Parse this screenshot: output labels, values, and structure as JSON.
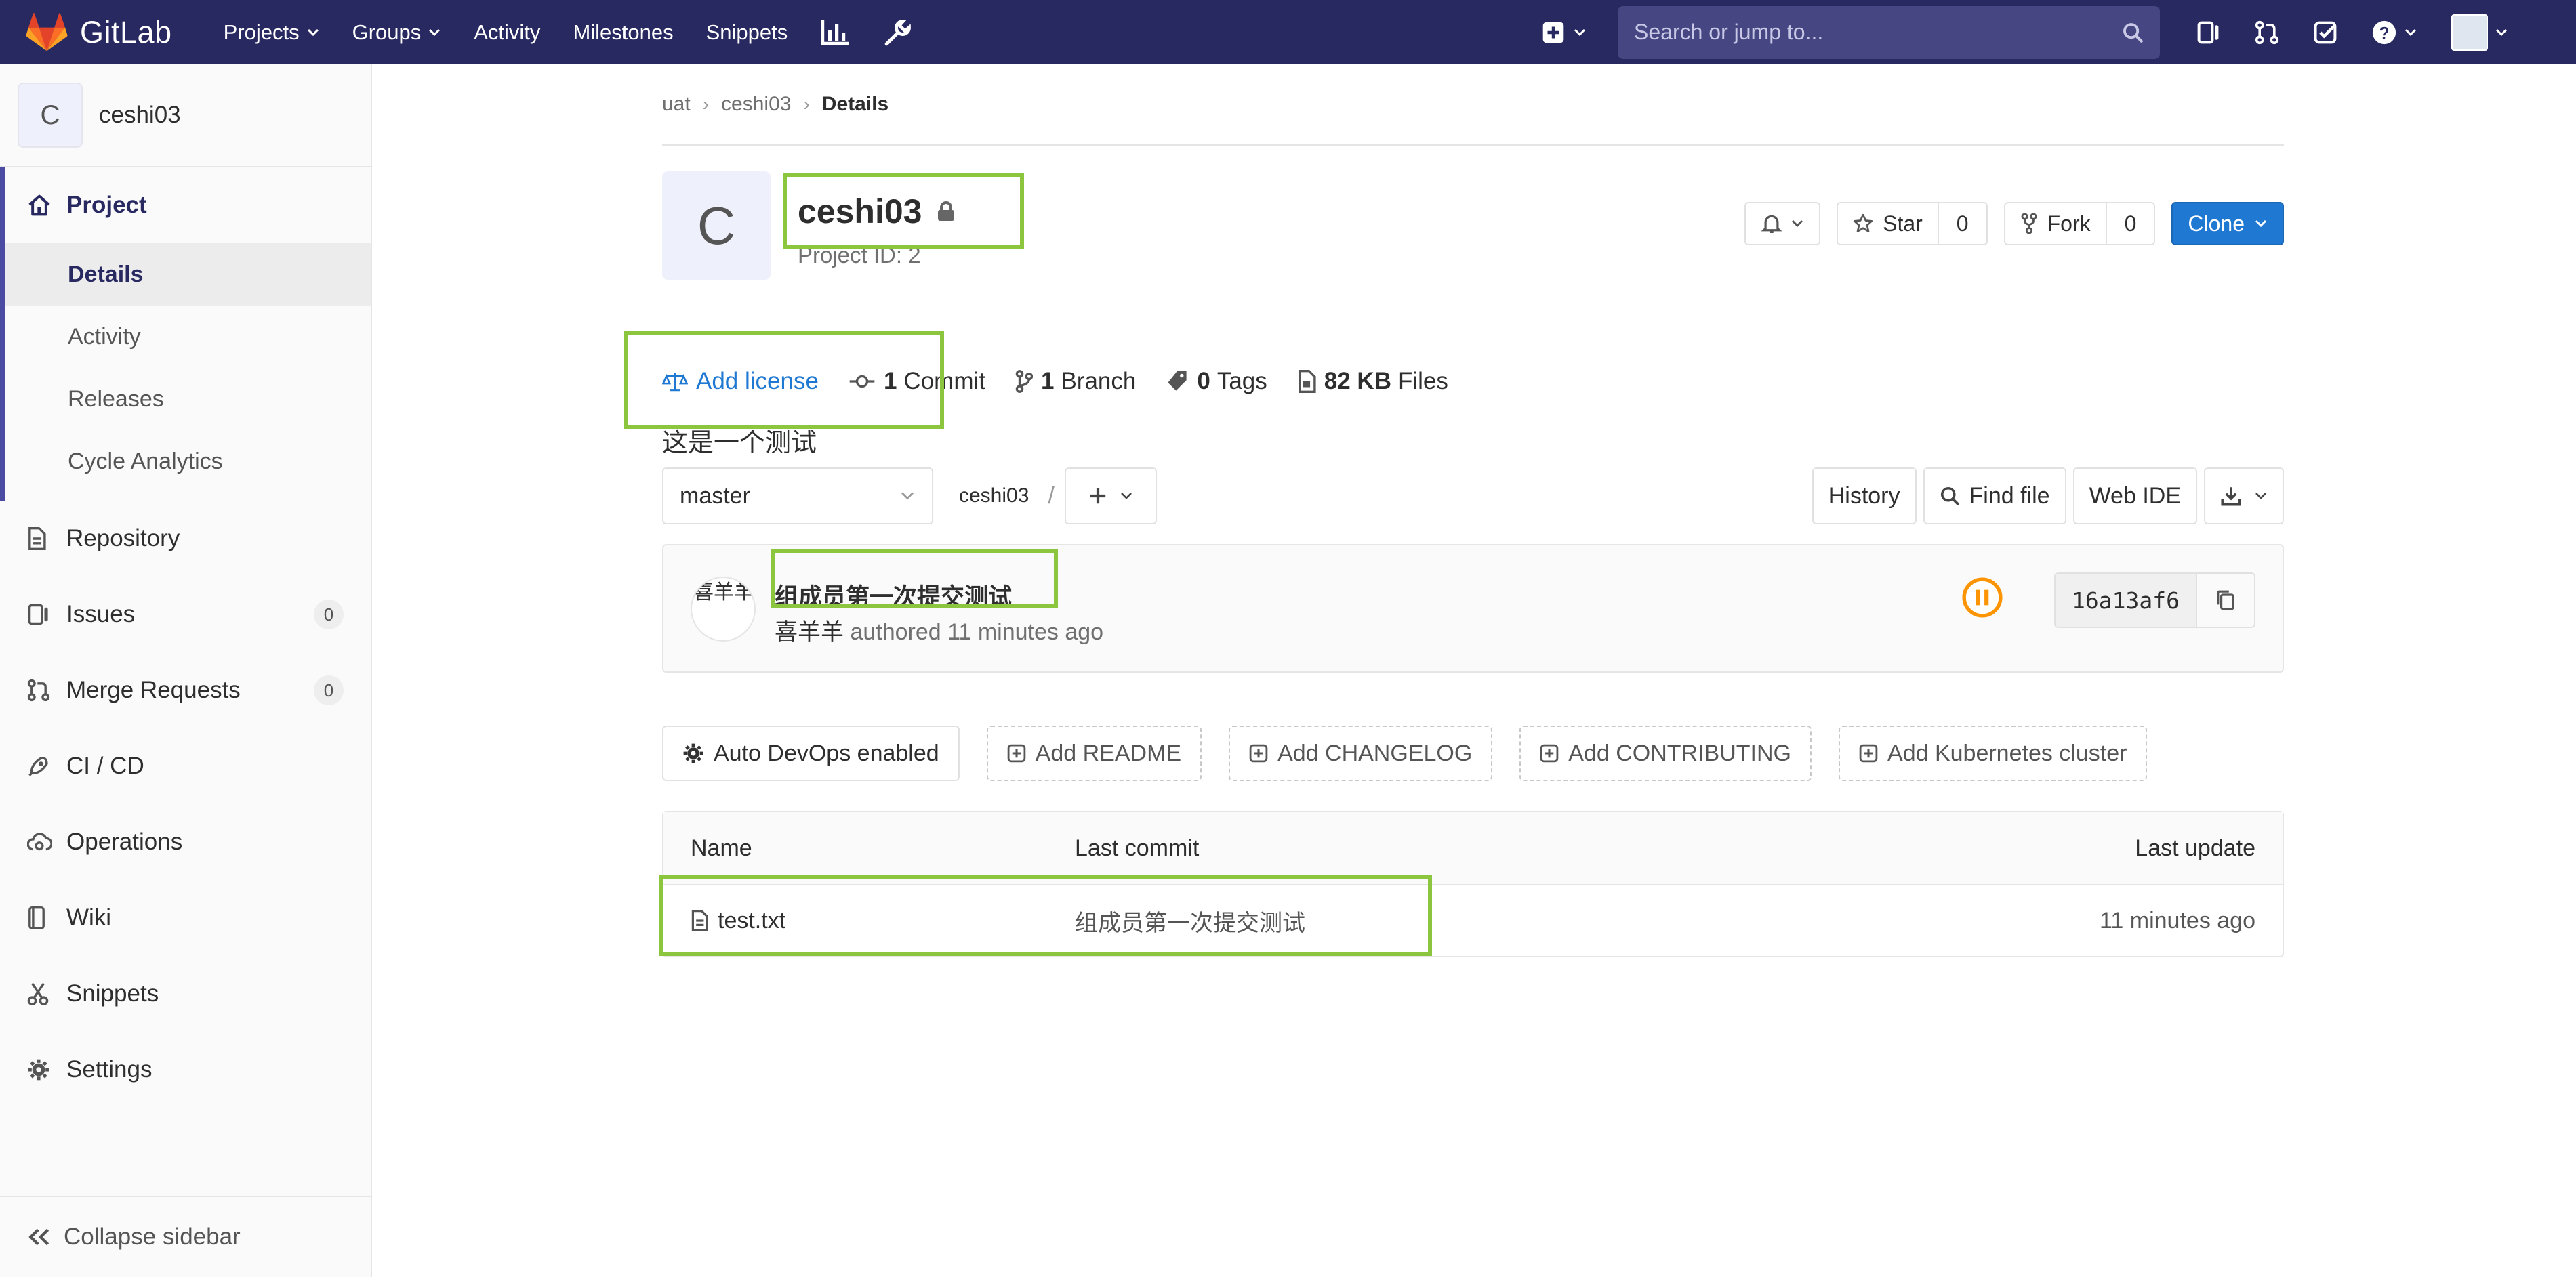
{
  "navbar": {
    "brand": "GitLab",
    "links": [
      {
        "label": "Projects",
        "dropdown": true
      },
      {
        "label": "Groups",
        "dropdown": true
      },
      {
        "label": "Activity",
        "dropdown": false
      },
      {
        "label": "Milestones",
        "dropdown": false
      },
      {
        "label": "Snippets",
        "dropdown": false
      }
    ],
    "search_placeholder": "Search or jump to...",
    "colors": {
      "bar": "#292961",
      "search": "#464682"
    }
  },
  "sidebar": {
    "project_initial": "C",
    "project_name": "ceshi03",
    "project_section": "Project",
    "project_sub": [
      "Details",
      "Activity",
      "Releases",
      "Cycle Analytics"
    ],
    "items": [
      {
        "label": "Repository",
        "icon": "repository-icon",
        "count": ""
      },
      {
        "label": "Issues",
        "icon": "issues-icon",
        "count": "0"
      },
      {
        "label": "Merge Requests",
        "icon": "merge-request-icon",
        "count": "0"
      },
      {
        "label": "CI / CD",
        "icon": "rocket-icon",
        "count": ""
      },
      {
        "label": "Operations",
        "icon": "cloud-gear-icon",
        "count": ""
      },
      {
        "label": "Wiki",
        "icon": "book-icon",
        "count": ""
      },
      {
        "label": "Snippets",
        "icon": "scissors-icon",
        "count": ""
      },
      {
        "label": "Settings",
        "icon": "gear-icon",
        "count": ""
      }
    ],
    "collapse_label": "Collapse sidebar"
  },
  "breadcrumb": [
    "uat",
    "ceshi03",
    "Details"
  ],
  "project": {
    "initial": "C",
    "title": "ceshi03",
    "id_label": "Project ID: 2",
    "star_label": "Star",
    "star_count": "0",
    "fork_label": "Fork",
    "fork_count": "0",
    "clone_label": "Clone",
    "stats": {
      "license": "Add license",
      "commits_num": "1",
      "commits_label": "Commit",
      "branches_num": "1",
      "branches_label": "Branch",
      "tags_num": "0",
      "tags_label": "Tags",
      "files_size": "82 KB",
      "files_label": "Files"
    },
    "description": "这是一个测试"
  },
  "tree": {
    "branch": "master",
    "path": "ceshi03",
    "path_sep": "/",
    "history_label": "History",
    "find_file_label": "Find file",
    "web_ide_label": "Web IDE"
  },
  "commit": {
    "avatar_alt": "喜羊羊",
    "title": "组成员第一次提交测试",
    "author": "喜羊羊",
    "meta": "authored 11 minutes ago",
    "sha": "16a13af6",
    "pipeline_color": "#fc9403"
  },
  "quick_actions": [
    {
      "label": "Auto DevOps enabled",
      "icon": "gear-icon",
      "style": "solid"
    },
    {
      "label": "Add README",
      "icon": "plus-square-icon",
      "style": "dashed"
    },
    {
      "label": "Add CHANGELOG",
      "icon": "plus-square-icon",
      "style": "dashed"
    },
    {
      "label": "Add CONTRIBUTING",
      "icon": "plus-square-icon",
      "style": "dashed"
    },
    {
      "label": "Add Kubernetes cluster",
      "icon": "plus-square-icon",
      "style": "dashed"
    }
  ],
  "files": {
    "headers": {
      "name": "Name",
      "last_commit": "Last commit",
      "last_update": "Last update"
    },
    "rows": [
      {
        "name": "test.txt",
        "last_commit": "组成员第一次提交测试",
        "last_update": "11 minutes ago"
      }
    ]
  },
  "colors": {
    "accent": "#1f78d1",
    "highlight": "#8cc63f"
  }
}
